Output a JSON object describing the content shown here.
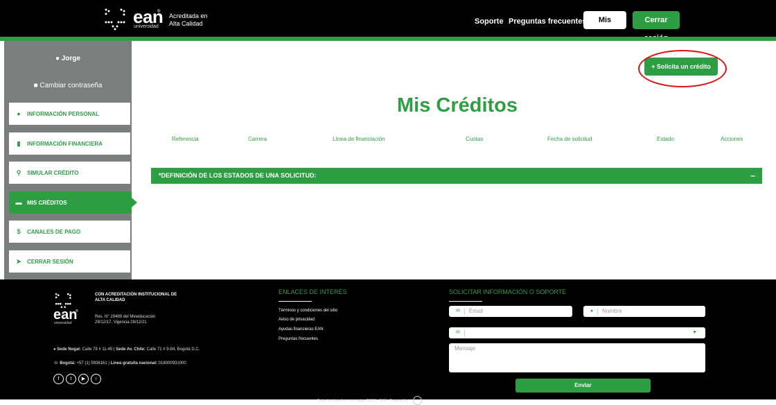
{
  "header": {
    "logo_text": "ean",
    "logo_sub": "universidad",
    "logo_reg": "®",
    "accreditation_line1": "Acreditada en",
    "accreditation_line2": "Alta Calidad",
    "nav": {
      "soporte": "Soporte",
      "faq": "Preguntas frecuentes",
      "mis_creditos": "Mis créditos",
      "logout": "Cerrar sesión"
    }
  },
  "sidebar": {
    "user_name": "Jorge",
    "change_password": "Cambiar contraseña",
    "items": [
      {
        "label": "INFORMACIÓN PERSONAL",
        "icon": "user-icon"
      },
      {
        "label": "INFORMACIÓN FINANCIERA",
        "icon": "document-icon"
      },
      {
        "label": "SIMULAR CRÉDITO",
        "icon": "search-icon"
      },
      {
        "label": "MIS CRÉDITOS",
        "icon": "card-icon",
        "active": true
      },
      {
        "label": "CANALES DE PAGO",
        "icon": "dollar-icon"
      },
      {
        "label": "CERRAR SESIÓN",
        "icon": "logout-icon"
      }
    ]
  },
  "main": {
    "request_button": "+ Solicita un crédito",
    "title": "Mis Créditos",
    "columns": [
      "Referencia",
      "Carrera",
      "Línea de financiación",
      "Cuotas",
      "Fecha de solicitud",
      "Estado",
      "Acciones"
    ],
    "definitions_bar": "*DEFINICIÓN DE LOS ESTADOS DE UNA SOLICITUD:",
    "definitions_toggle": "–"
  },
  "footer": {
    "logo_text": "ean",
    "logo_reg": "®",
    "logo_sub": "universidad",
    "accreditation": "CON ACREDITACIÓN INSTITUCIONAL DE ALTA CALIDAD",
    "resolution": "Res. N° 29499 del Mineducación 29/12/17, Vigencia 28/12/21",
    "address_label1": "Sede Nogal:",
    "address_value1": "Calle 79 # 11-45 |",
    "address_label2": "Sede Av. Chile:",
    "address_value2": "Calle 71 # 9-84, Bogotá D.C.",
    "phone_label1": "Bogotá:",
    "phone_value1": "+57 (1) 5936161 |",
    "phone_label2": "Línea gratuita nacional:",
    "phone_value2": "018000931000",
    "links_title": "ENLACES DE INTERÉS",
    "links": [
      "Términos y condiciones del sitio",
      "Aviso de privacidad",
      "Ayudas financieras EAN",
      "Preguntas frecuentes"
    ],
    "support_title": "SOLICITAR INFORMACIÓN O SOPORTE",
    "email_placeholder": "Email",
    "name_placeholder": "Nombre",
    "message_placeholder": "Mensaje",
    "send_button": "Enviar",
    "rights": "Todos los derechos reservados ©2021 - EAN - Powered by"
  },
  "colors": {
    "brand_green": "#2e9e44",
    "highlight_red": "#e01010",
    "sidebar_gray": "#7a7f7d"
  }
}
